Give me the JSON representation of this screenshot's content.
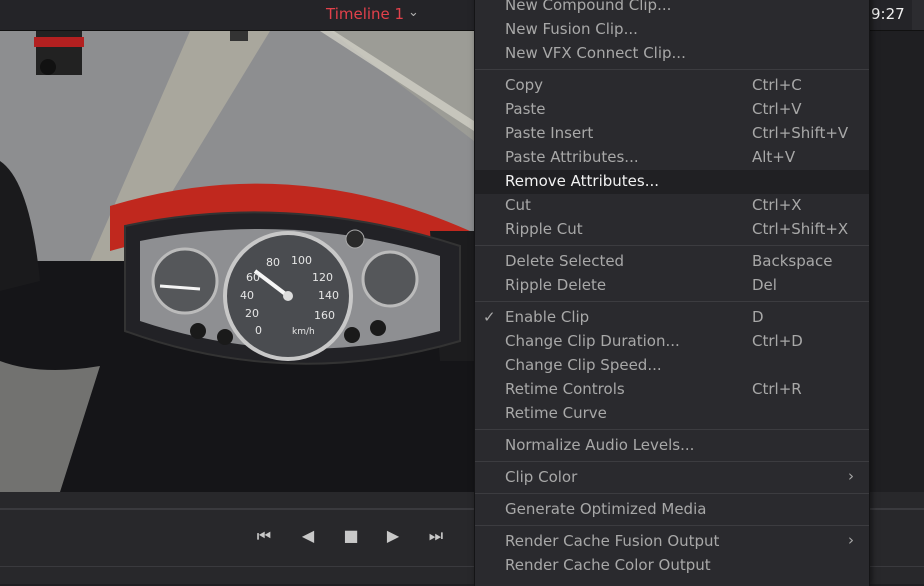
{
  "timeline": {
    "title": "Timeline 1",
    "chevron": "⌄"
  },
  "timecode": "9:27",
  "transport": {
    "buttons": [
      {
        "name": "jump-to-start-icon",
        "glyph": "⏮"
      },
      {
        "name": "play-reverse-icon",
        "glyph": "◀"
      },
      {
        "name": "stop-icon",
        "glyph": "■"
      },
      {
        "name": "play-icon",
        "glyph": "▶"
      },
      {
        "name": "jump-to-end-icon",
        "glyph": "⏭"
      }
    ]
  },
  "speedometer": {
    "ticks": [
      "0",
      "20",
      "40",
      "60",
      "80",
      "100",
      "120",
      "140",
      "160"
    ],
    "unit": "km/h"
  },
  "context_menu": {
    "groups": [
      [
        {
          "label": "New Compound Clip...",
          "shortcut": ""
        },
        {
          "label": "New Fusion Clip...",
          "shortcut": ""
        },
        {
          "label": "New VFX Connect Clip...",
          "shortcut": ""
        }
      ],
      [
        {
          "label": "Copy",
          "shortcut": "Ctrl+C"
        },
        {
          "label": "Paste",
          "shortcut": "Ctrl+V"
        },
        {
          "label": "Paste Insert",
          "shortcut": "Ctrl+Shift+V"
        },
        {
          "label": "Paste Attributes...",
          "shortcut": "Alt+V"
        },
        {
          "label": "Remove Attributes...",
          "shortcut": "",
          "highlighted": true
        },
        {
          "label": "Cut",
          "shortcut": "Ctrl+X"
        },
        {
          "label": "Ripple Cut",
          "shortcut": "Ctrl+Shift+X"
        }
      ],
      [
        {
          "label": "Delete Selected",
          "shortcut": "Backspace"
        },
        {
          "label": "Ripple Delete",
          "shortcut": "Del"
        }
      ],
      [
        {
          "label": "Enable Clip",
          "shortcut": "D",
          "checked": true
        },
        {
          "label": "Change Clip Duration...",
          "shortcut": "Ctrl+D"
        },
        {
          "label": "Change Clip Speed...",
          "shortcut": ""
        },
        {
          "label": "Retime Controls",
          "shortcut": "Ctrl+R"
        },
        {
          "label": "Retime Curve",
          "shortcut": ""
        }
      ],
      [
        {
          "label": "Normalize Audio Levels...",
          "shortcut": ""
        }
      ],
      [
        {
          "label": "Clip Color",
          "shortcut": "",
          "submenu": true
        }
      ],
      [
        {
          "label": "Generate Optimized Media",
          "shortcut": ""
        }
      ],
      [
        {
          "label": "Render Cache Fusion Output",
          "shortcut": "",
          "submenu": true
        },
        {
          "label": "Render Cache Color Output",
          "shortcut": ""
        }
      ]
    ]
  }
}
